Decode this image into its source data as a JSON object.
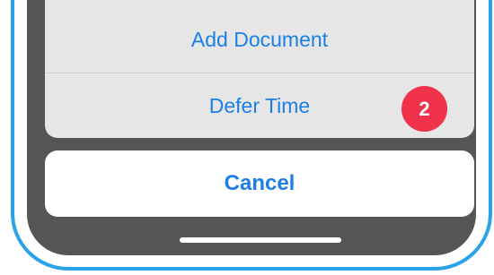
{
  "action_sheet": {
    "items": [
      {
        "label": "Add Document"
      },
      {
        "label": "Defer Time",
        "badge": "2"
      }
    ],
    "cancel_label": "Cancel"
  },
  "colors": {
    "frame": "#29a3e6",
    "screen": "#555555",
    "sheet": "#e6e6e6",
    "action_text": "#1b7fe6",
    "badge": "#f0324b"
  }
}
